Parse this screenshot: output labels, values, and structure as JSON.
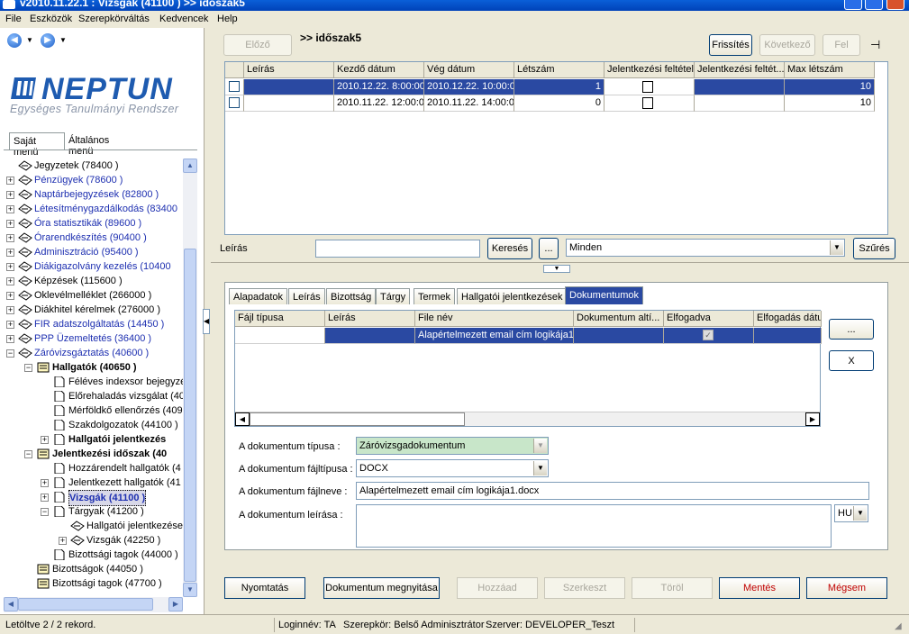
{
  "window": {
    "title": "v2010.11.22.1 : Vizsgák (41100 ) >> időszak5"
  },
  "menu": [
    "File",
    "Eszközök",
    "Szerepkörváltás",
    "Kedvencek",
    "Help"
  ],
  "logo": {
    "brand": "NEPTUN",
    "tagline": "Egységes Tanulmányi Rendszer"
  },
  "left_tabs": {
    "own": "Saját menü",
    "general": "Általános menü"
  },
  "tree": [
    {
      "label": "Jegyzetek (78400 )",
      "level": 0,
      "exp": "",
      "icon": "link",
      "color": "black"
    },
    {
      "label": "Pénzügyek (78600 )",
      "level": 0,
      "exp": "+",
      "icon": "link",
      "color": "blue"
    },
    {
      "label": "Naptárbejegyzések (82800 )",
      "level": 0,
      "exp": "+",
      "icon": "link",
      "color": "blue"
    },
    {
      "label": "Létesítménygazdálkodás (83400",
      "level": 0,
      "exp": "+",
      "icon": "link",
      "color": "blue"
    },
    {
      "label": "Óra statisztikák (89600 )",
      "level": 0,
      "exp": "+",
      "icon": "link",
      "color": "blue"
    },
    {
      "label": "Órarendkészítés (90400 )",
      "level": 0,
      "exp": "+",
      "icon": "link",
      "color": "blue"
    },
    {
      "label": "Adminisztráció (95400 )",
      "level": 0,
      "exp": "+",
      "icon": "link",
      "color": "blue"
    },
    {
      "label": "Diákigazolvány kezelés (10400",
      "level": 0,
      "exp": "+",
      "icon": "link",
      "color": "blue"
    },
    {
      "label": "Képzések (115600 )",
      "level": 0,
      "exp": "+",
      "icon": "link",
      "color": "black"
    },
    {
      "label": "Oklevélmelléklet (266000 )",
      "level": 0,
      "exp": "+",
      "icon": "link",
      "color": "black"
    },
    {
      "label": "Diákhitel kérelmek (276000 )",
      "level": 0,
      "exp": "+",
      "icon": "link",
      "color": "black"
    },
    {
      "label": "FIR adatszolgáltatás (14450 )",
      "level": 0,
      "exp": "+",
      "icon": "link",
      "color": "blue"
    },
    {
      "label": "PPP Üzemeltetés (36400 )",
      "level": 0,
      "exp": "+",
      "icon": "link",
      "color": "blue"
    },
    {
      "label": "Záróvizsgáztatás (40600 )",
      "level": 0,
      "exp": "−",
      "icon": "link",
      "color": "blue"
    },
    {
      "label": "Hallgatók (40650 )",
      "level": 1,
      "exp": "−",
      "icon": "form",
      "color": "black",
      "bold": true
    },
    {
      "label": "Féléves indexsor bejegyzé",
      "level": 2,
      "exp": "",
      "icon": "doc",
      "color": "black"
    },
    {
      "label": "Előrehaladás vizsgálat (40",
      "level": 2,
      "exp": "",
      "icon": "doc",
      "color": "black"
    },
    {
      "label": "Mérföldkő ellenőrzés (409",
      "level": 2,
      "exp": "",
      "icon": "doc",
      "color": "black"
    },
    {
      "label": "Szakdolgozatok (44100 )",
      "level": 2,
      "exp": "",
      "icon": "doc",
      "color": "black"
    },
    {
      "label": "Hallgatói jelentkezés",
      "level": 2,
      "exp": "+",
      "icon": "doc",
      "color": "black",
      "bold": true
    },
    {
      "label": "Jelentkezési időszak (40",
      "level": 1,
      "exp": "−",
      "icon": "form",
      "color": "black",
      "bold": true
    },
    {
      "label": "Hozzárendelt hallgatók (4",
      "level": 2,
      "exp": "",
      "icon": "doc",
      "color": "black"
    },
    {
      "label": "Jelentkezett hallgatók (41",
      "level": 2,
      "exp": "+",
      "icon": "doc",
      "color": "black"
    },
    {
      "label": "Vizsgák (41100 )",
      "level": 2,
      "exp": "+",
      "icon": "doc",
      "color": "blue",
      "bold": true,
      "selected": true
    },
    {
      "label": "Tárgyak (41200 )",
      "level": 2,
      "exp": "−",
      "icon": "doc",
      "color": "black"
    },
    {
      "label": "Hallgatói jelentkezése",
      "level": 3,
      "exp": "",
      "icon": "link",
      "color": "black"
    },
    {
      "label": "Vizsgák (42250 )",
      "level": 3,
      "exp": "+",
      "icon": "link",
      "color": "black"
    },
    {
      "label": "Bizottsági tagok (44000 )",
      "level": 2,
      "exp": "",
      "icon": "doc",
      "color": "black"
    },
    {
      "label": "Bizottságok (44050 )",
      "level": 1,
      "exp": "",
      "icon": "form",
      "color": "black"
    },
    {
      "label": "Bizottsági tagok (47700 )",
      "level": 1,
      "exp": "",
      "icon": "form",
      "color": "black"
    }
  ],
  "top": {
    "prev": "Előző",
    "breadcrumb": ">> időszak5",
    "refresh": "Frissítés",
    "next": "Következő",
    "up": "Fel",
    "pin_icon": "pin-icon"
  },
  "grid1": {
    "headers": [
      "Leírás",
      "Kezdő dátum",
      "Vég dátum",
      "Létszám",
      "Jelentkezési feltétel",
      "Jelentkezési feltét...",
      "Max létszám"
    ],
    "rows": [
      {
        "leiras": "",
        "kezdo": "2010.12.22. 8:00:00",
        "veg": "2010.12.22. 10:00:0",
        "letszam": "1",
        "max": "10"
      },
      {
        "leiras": "",
        "kezdo": "2010.11.22. 12:00:0",
        "veg": "2010.11.22. 14:00:0",
        "letszam": "0",
        "max": "10"
      }
    ]
  },
  "search": {
    "label": "Leírás",
    "input_value": "",
    "search_button": "Keresés",
    "ellipsis": "...",
    "filter_value": "Minden",
    "filter_button": "Szűrés"
  },
  "tabs": [
    "Alapadatok",
    "Leírás",
    "Bizottság",
    "Tárgy",
    "Termek",
    "Hallgatói jelentkezések",
    "Dokumentumok"
  ],
  "grid2": {
    "headers": [
      "Fájl típusa",
      "Leírás",
      "File név",
      "Dokumentum altí...",
      "Elfogadva",
      "Elfogadás dátu"
    ],
    "rows": [
      {
        "tipus": "",
        "leiras": "",
        "filenev": "Alapértelmezett email cím logikája1.d",
        "altipus": "",
        "elfogadva": true,
        "datum": ""
      }
    ],
    "side_button": "...",
    "delete_button": "X"
  },
  "form": {
    "type_label": "A dokumentum típusa :",
    "type_value": "Záróvizsgadokumentum",
    "filetype_label": "A dokumentum fájltípusa :",
    "filetype_value": "DOCX",
    "filename_label": "A dokumentum fájlneve :",
    "filename_value": "Alapértelmezett email cím logikája1.docx",
    "desc_label": "A dokumentum leírása :",
    "desc_value": "",
    "lang_value": "HU"
  },
  "actions": {
    "print": "Nyomtatás",
    "open_doc": "Dokumentum megnyitása",
    "add": "Hozzáad",
    "edit": "Szerkeszt",
    "delete": "Töröl",
    "save": "Mentés",
    "cancel": "Mégsem"
  },
  "status": {
    "loaded": "Letöltve 2 / 2 rekord.",
    "login": "Loginnév: TA",
    "role": "Szerepkör: Belső Adminisztrátor",
    "server": "Szerver: DEVELOPER_Teszt"
  },
  "colors": {
    "selection": "#2a49a2",
    "accent": "#1e5bb0",
    "danger": "#c00000",
    "green_field": "#c8e6c9"
  }
}
